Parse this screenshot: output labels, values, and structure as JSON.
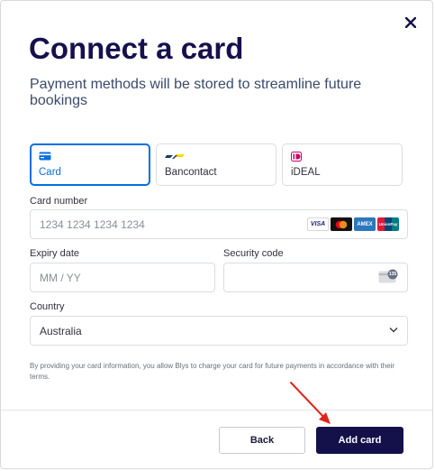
{
  "modal": {
    "title": "Connect a card",
    "subtitle": "Payment methods will be stored to streamline future bookings",
    "close_icon": "close-icon"
  },
  "tabs": [
    {
      "label": "Card",
      "icon": "card-icon",
      "active": true
    },
    {
      "label": "Bancontact",
      "icon": "bancontact-icon",
      "active": false
    },
    {
      "label": "iDEAL",
      "icon": "ideal-icon",
      "active": false
    }
  ],
  "card_number": {
    "label": "Card number",
    "placeholder": "1234 1234 1234 1234",
    "brands": [
      "visa-icon",
      "mastercard-icon",
      "amex-icon",
      "unionpay-icon"
    ],
    "brand_text": {
      "visa": "VISA",
      "amex": "AMEX",
      "unionpay": "UnionPay"
    }
  },
  "expiry": {
    "label": "Expiry date",
    "placeholder": "MM / YY"
  },
  "security": {
    "label": "Security code",
    "placeholder": "",
    "icon": "cvc-card-icon",
    "icon_text": "135"
  },
  "country": {
    "label": "Country",
    "value": "Australia"
  },
  "terms": "By providing your card information, you allow Blys to charge your card for future payments in accordance with their terms.",
  "buttons": {
    "back": "Back",
    "add": "Add card"
  },
  "colors": {
    "accent": "#0570de",
    "primary": "#14114a",
    "annotation_arrow": "#e0261b"
  }
}
